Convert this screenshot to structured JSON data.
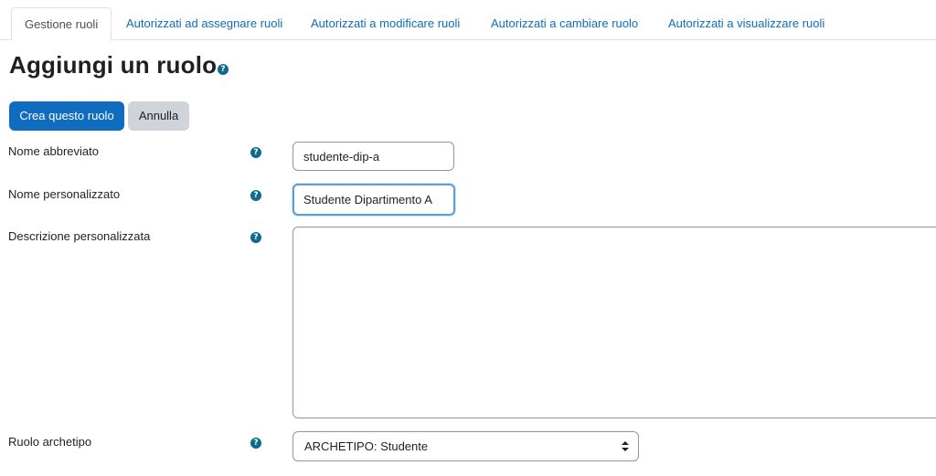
{
  "tabs": [
    {
      "label": "Gestione ruoli",
      "active": true
    },
    {
      "label": "Autorizzati ad assegnare ruoli",
      "active": false
    },
    {
      "label": "Autorizzati a modificare ruoli",
      "active": false
    },
    {
      "label": "Autorizzati a cambiare ruolo",
      "active": false
    },
    {
      "label": "Autorizzati a visualizzare ruoli",
      "active": false
    }
  ],
  "page": {
    "title": "Aggiungi un ruolo"
  },
  "buttons": {
    "create_label": "Crea questo ruolo",
    "cancel_label": "Annulla"
  },
  "form": {
    "short_name": {
      "label": "Nome abbreviato",
      "value": "studente-dip-a"
    },
    "custom_name": {
      "label": "Nome personalizzato",
      "value": "Studente Dipartimento A"
    },
    "description": {
      "label": "Descrizione personalizzata",
      "value": ""
    },
    "archetype": {
      "label": "Ruolo archetipo",
      "selected": "ARCHETIPO: Studente"
    }
  },
  "icons": {
    "help": "question-circle-icon",
    "select_arrow": "updown-arrow-icon"
  },
  "colors": {
    "primary": "#0f6cbf",
    "secondary": "#ced4da",
    "help_icon": "#0f6a8b",
    "focus": "#5e9ed6"
  }
}
